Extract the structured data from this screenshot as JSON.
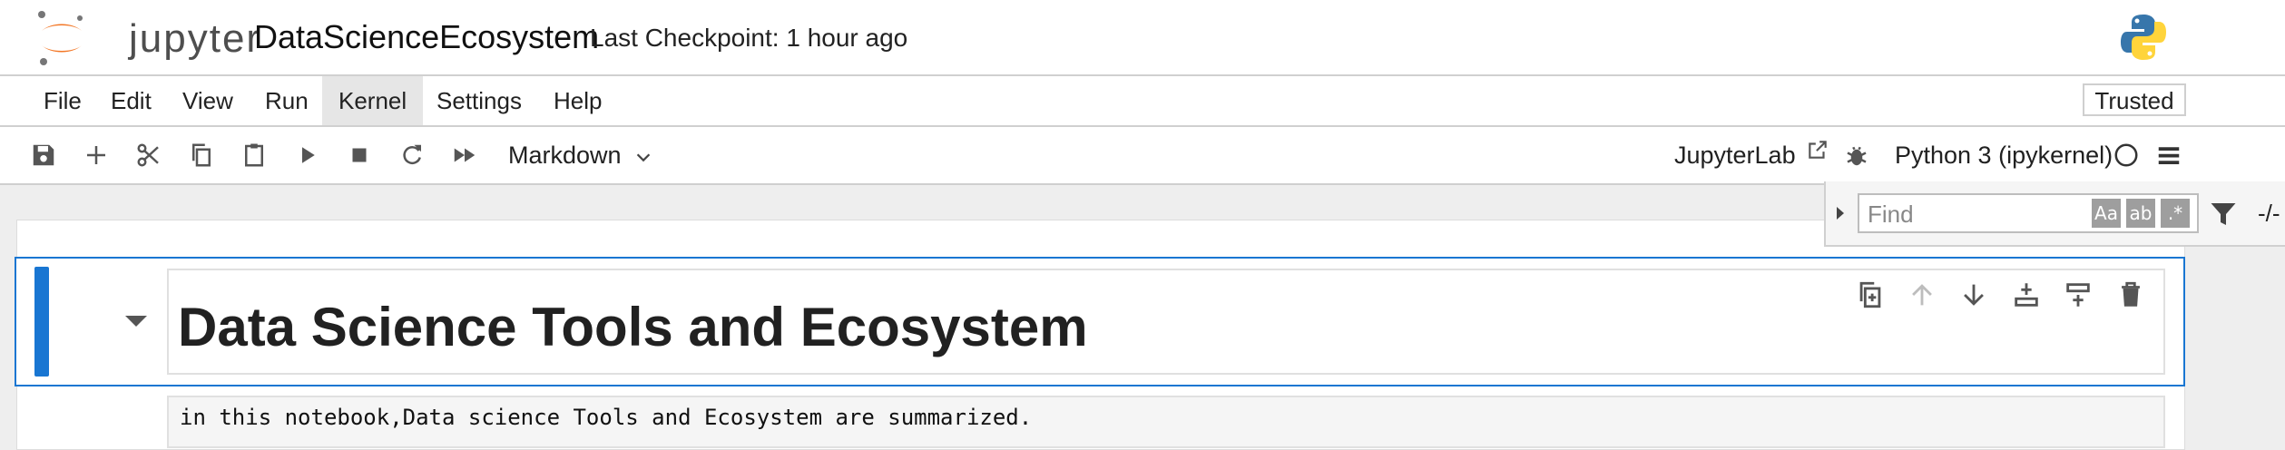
{
  "header": {
    "logo_text": "jupyter",
    "notebook_title": "DataScienceEcosystem",
    "checkpoint": "Last Checkpoint: 1 hour ago",
    "logo_icon": "jupyter-logo-icon",
    "kernel_logo_icon": "python-logo-icon"
  },
  "menu": {
    "items": [
      "File",
      "Edit",
      "View",
      "Run",
      "Kernel",
      "Settings",
      "Help"
    ],
    "active": "Kernel",
    "trusted_label": "Trusted"
  },
  "toolbar": {
    "icons": [
      "save-icon",
      "add-icon",
      "cut-icon",
      "copy-icon",
      "paste-icon",
      "run-icon",
      "stop-icon",
      "restart-icon",
      "fast-forward-icon"
    ],
    "cell_type": "Markdown",
    "jupyterlab_label": "JupyterLab",
    "kernel_name": "Python 3 (ipykernel)"
  },
  "find": {
    "placeholder": "Find",
    "opt_case": "Aa",
    "opt_word": "ab",
    "opt_regex": ".*",
    "match_count": "-/-"
  },
  "cells": {
    "heading": "Data Science Tools and Ecosystem",
    "text": "in this notebook,Data science Tools and Ecosystem are summarized."
  },
  "colors": {
    "accent": "#1976d2",
    "jupyter_orange": "#f37726"
  }
}
